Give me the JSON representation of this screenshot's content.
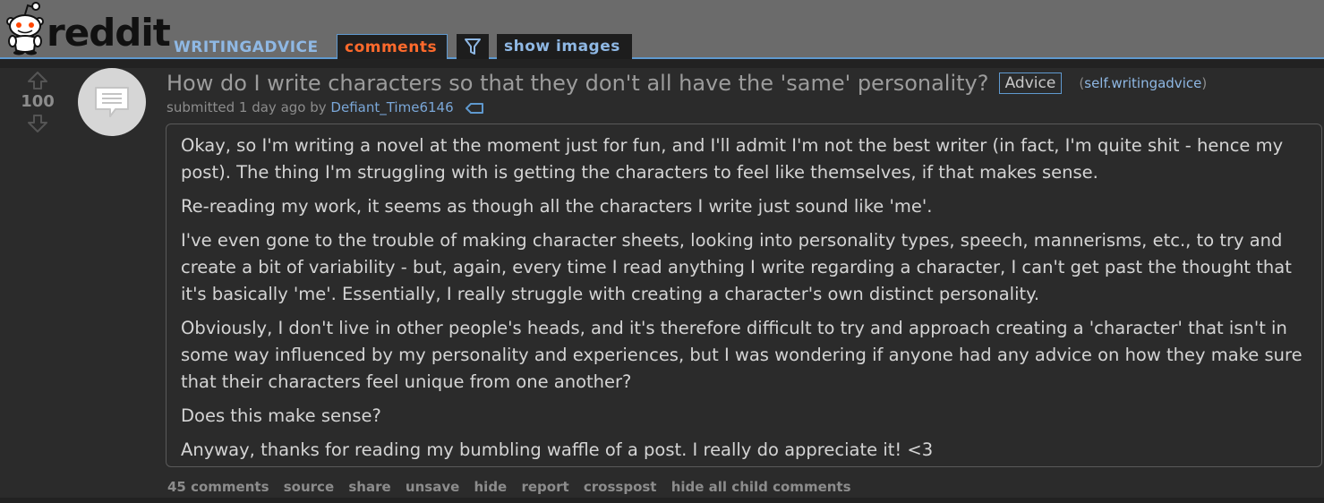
{
  "header": {
    "logo_text": "reddit",
    "subreddit": "WRITINGADVICE",
    "tabs": {
      "comments": "comments",
      "show_images": "show images"
    }
  },
  "post": {
    "score": "100",
    "title": "How do I write characters so that they don't all have the 'same' personality?",
    "flair": "Advice",
    "domain_open": "(",
    "domain": "self.writingadvice",
    "domain_close": ")",
    "submitted_prefix": "submitted 1 day ago by",
    "author": "Defiant_Time6146",
    "paragraphs": [
      "Okay, so I'm writing a novel at the moment just for fun, and I'll admit I'm not the best writer (in fact, I'm quite shit - hence my post). The thing I'm struggling with is getting the characters to feel like themselves, if that makes sense.",
      "Re-reading my work, it seems as though all the characters I write just sound like 'me'.",
      "I've even gone to the trouble of making character sheets, looking into personality types, speech, mannerisms, etc., to try and create a bit of variability - but, again, every time I read anything I write regarding a character, I can't get past the thought that it's basically 'me'. Essentially, I really struggle with creating a character's own distinct personality.",
      "Obviously, I don't live in other people's heads, and it's therefore difficult to try and approach creating a 'character' that isn't in some way influenced by my personality and experiences, but I was wondering if anyone had any advice on how they make sure that their characters feel unique from one another?",
      "Does this make sense?",
      "Anyway, thanks for reading my bumbling waffle of a post. I really do appreciate it! <3"
    ],
    "buttons": {
      "comments": "45 comments",
      "source": "source",
      "share": "share",
      "unsave": "unsave",
      "hide": "hide",
      "report": "report",
      "crosspost": "crosspost",
      "hide_child": "hide all child comments"
    }
  },
  "icons": {
    "logo": "reddit-alien-icon",
    "filter": "filter-funnel-icon",
    "upvote": "upvote-arrow-icon",
    "downvote": "downvote-arrow-icon",
    "thumbnail": "self-post-text-icon",
    "tag": "tag-icon"
  },
  "colors": {
    "header_bg": "#6b6b6b",
    "accent_blue": "#5f99cf",
    "comments_tab": "#ff6a2c",
    "link": "#8fb8e4",
    "body_text": "#d4d4d4",
    "page_bg": "#222222"
  }
}
